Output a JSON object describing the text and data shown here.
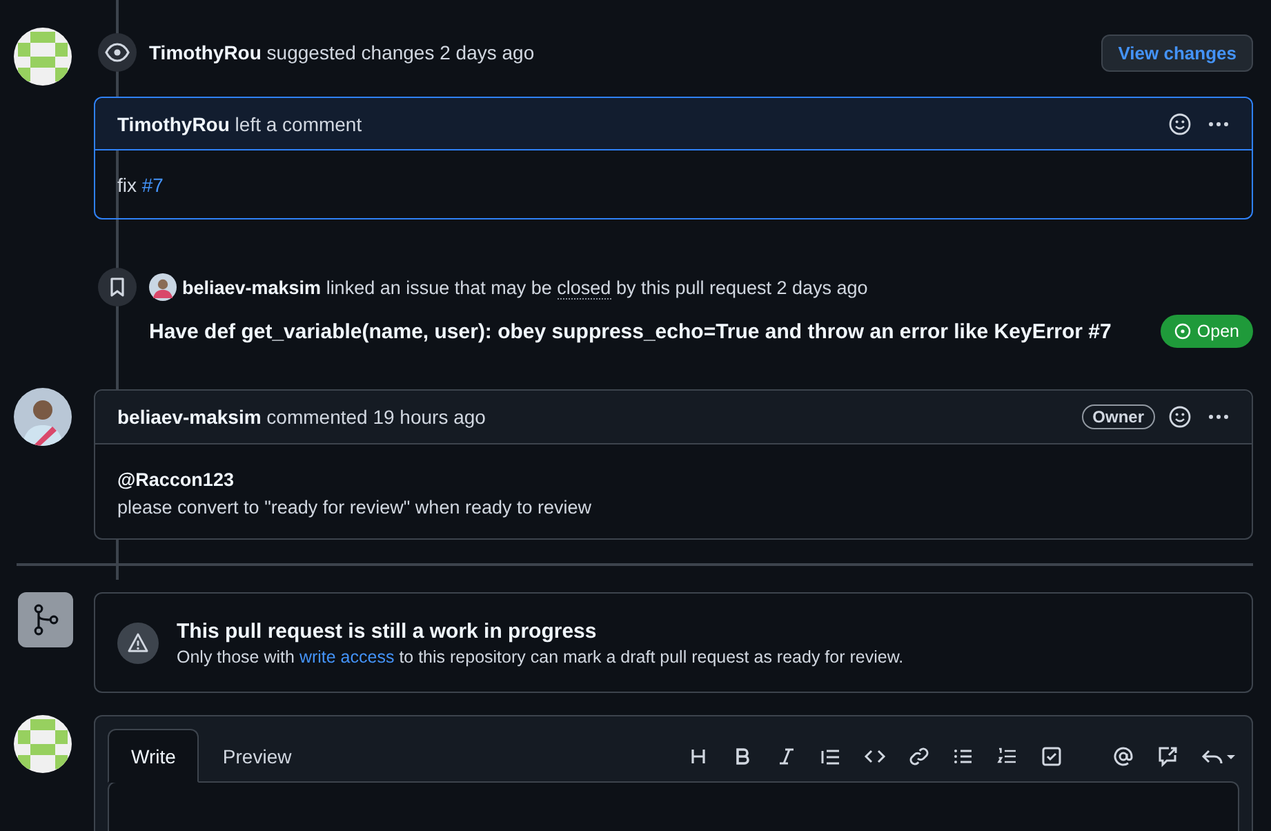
{
  "review": {
    "header": "**TimothyRou** suggested changes 2 days ago",
    "button": "View changes",
    "comment": {
      "header": "**TimothyRou** left a comment",
      "body_text": "fix",
      "body_link": "#7"
    }
  },
  "linked": {
    "author": "beliaev-maksim",
    "text_before": "linked an issue that may be",
    "underlined": "closed",
    "text_after": "by this pull request 2 days ago",
    "issue_title": "Have def get_variable(name, user): obey suppress_echo=True and throw an error like KeyError #7",
    "status": "Open"
  },
  "comment": {
    "header": "**beliaev-maksim** commented 19 hours ago",
    "badge": "Owner",
    "mention": "@Raccon123",
    "body": "please convert to \"ready for review\" when ready to review"
  },
  "draft_notice": {
    "title": "This pull request is still a work in progress",
    "text_before": "Only those with",
    "link": "write access",
    "text_after": "to this repository can mark a draft pull request as ready for review."
  },
  "editor": {
    "tabs": [
      {
        "label": "Write",
        "selected": true
      },
      {
        "label": "Preview",
        "selected": false
      }
    ]
  }
}
